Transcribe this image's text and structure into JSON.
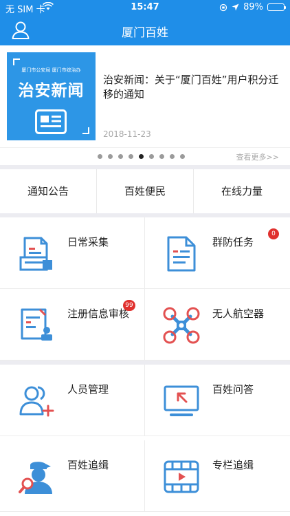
{
  "status_bar": {
    "carrier": "无 SIM 卡",
    "time": "15:47",
    "battery": "89%",
    "battery_level": 0.89
  },
  "nav": {
    "title": "厦门百姓",
    "user_icon": "user-icon"
  },
  "news": {
    "thumbnail_org": "厦门市公安局 厦门市综治办",
    "thumbnail_title": "治安新闻",
    "title": "治安新闻：关于“厦门百姓”用户积分迁移的通知",
    "date": "2018-11-23",
    "more_label": "查看更多>>",
    "pager_count": 9,
    "pager_active": 4
  },
  "tabs": [
    {
      "label": "通知公告"
    },
    {
      "label": "百姓便民"
    },
    {
      "label": "在线力量"
    }
  ],
  "section1": [
    {
      "label": "日常采集",
      "icon": "document-stack-icon"
    },
    {
      "label": "群防任务",
      "icon": "document-icon",
      "badge": "0"
    },
    {
      "label": "注册信息审核",
      "icon": "registration-review-icon",
      "badge": "99"
    },
    {
      "label": "无人航空器",
      "icon": "drone-icon"
    }
  ],
  "section2": [
    {
      "label": "人员管理",
      "icon": "add-person-icon"
    },
    {
      "label": "百姓问答",
      "icon": "monitor-arrow-icon"
    },
    {
      "label": "百姓追缉",
      "icon": "suspect-search-icon"
    },
    {
      "label": "专栏追缉",
      "icon": "video-play-icon"
    }
  ],
  "colors": {
    "primary": "#1f8ee8",
    "badge": "#e0312e",
    "icon_blue": "#3d8fd8",
    "icon_red": "#e35151"
  }
}
